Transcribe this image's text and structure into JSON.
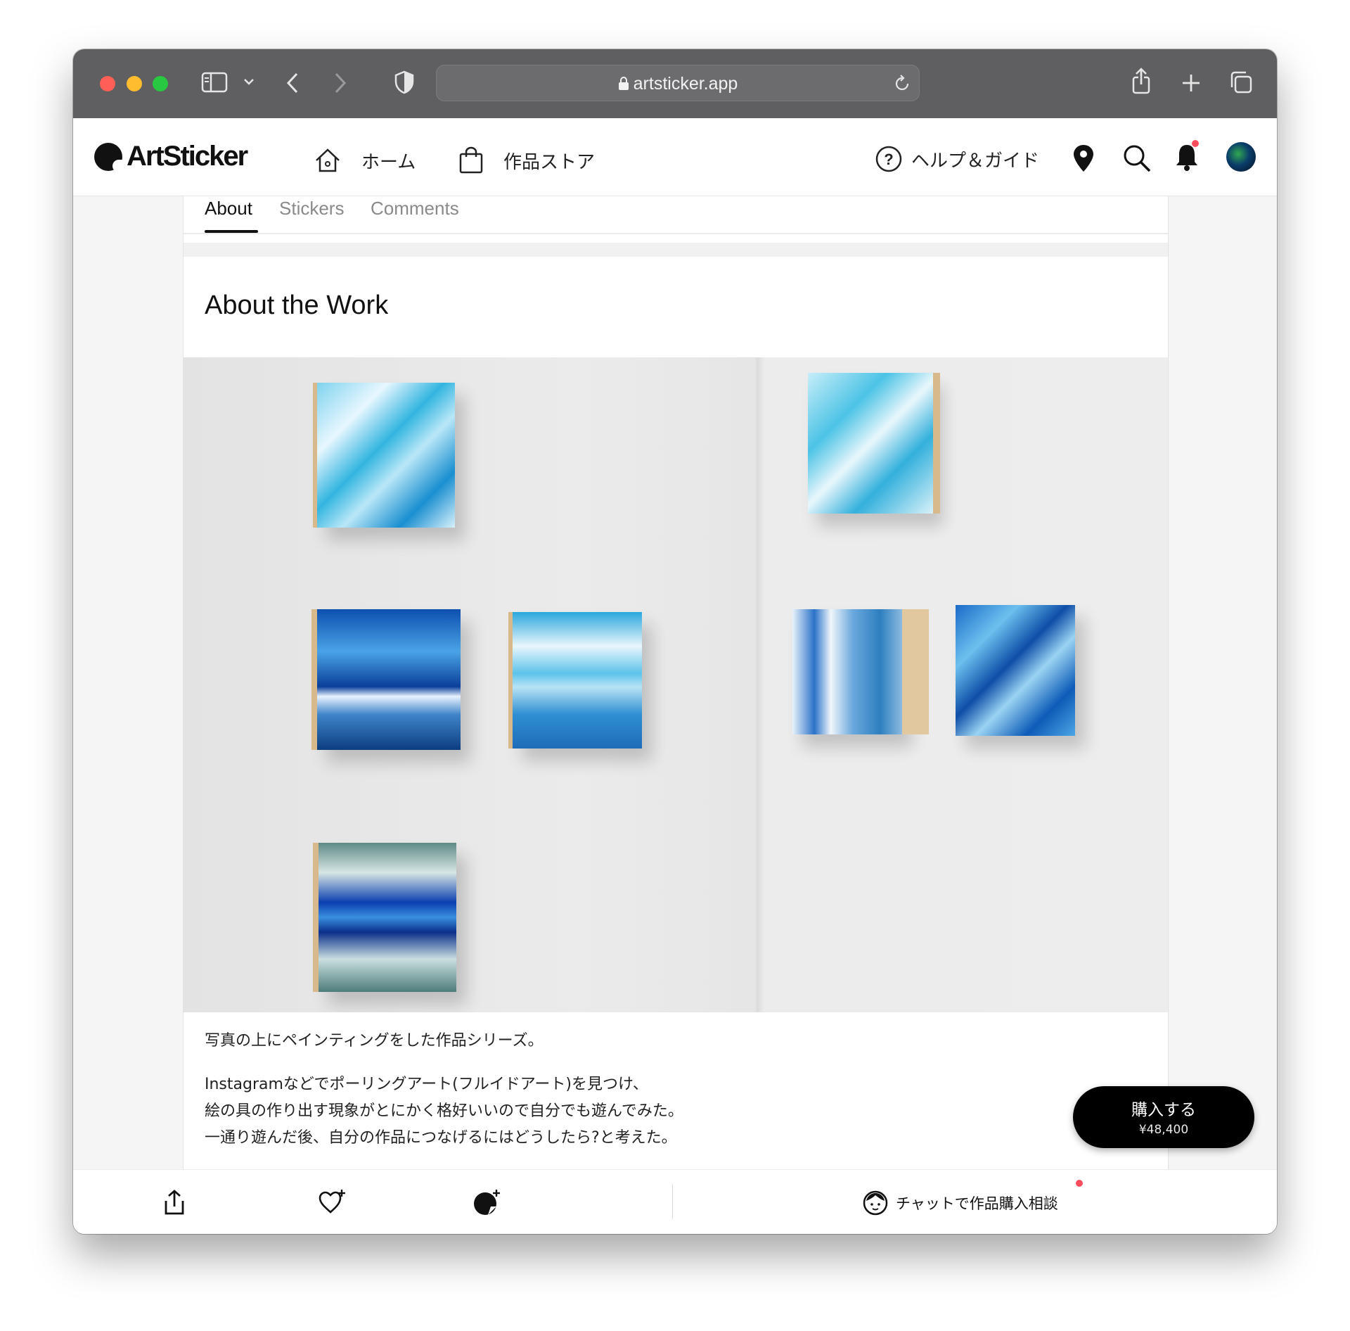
{
  "browser": {
    "url": "artsticker.app"
  },
  "header": {
    "logo_text": "ArtSticker",
    "nav": [
      {
        "label": "ホーム",
        "icon": "home-icon"
      },
      {
        "label": "作品ストア",
        "icon": "shopping-bag-icon"
      }
    ],
    "help_label": "ヘルプ＆ガイド",
    "right_icons": [
      "location-pin-icon",
      "search-icon",
      "bell-icon",
      "avatar"
    ],
    "notification_dot_color": "#ff4d5e"
  },
  "tabs": [
    {
      "label": "About",
      "active": true
    },
    {
      "label": "Stickers",
      "active": false
    },
    {
      "label": "Comments",
      "active": false
    }
  ],
  "section": {
    "title": "About the Work",
    "image_alt_icon": "artwork-installation-photo"
  },
  "description": {
    "para1": "写真の上にペインティングをした作品シリーズ。",
    "para2_lines": [
      "Instagramなどでポーリングアート(フルイドアート)を見つけ、",
      "絵の具の作り出す現象がとにかく格好いいので自分でも遊んでみた。",
      "一通り遊んだ後、自分の作品につなげるにはどうしたら?と考えた。"
    ]
  },
  "purchase": {
    "label": "購入する",
    "price": "¥48,400"
  },
  "bottom_bar": {
    "icons": [
      "share-icon",
      "like-plus-icon",
      "sticker-plus-icon"
    ],
    "chat_label": "チャットで作品購入相談",
    "chat_icon": "chat-face-icon"
  },
  "colors": {
    "accent": "#000000",
    "badge": "#ff4d5e"
  }
}
